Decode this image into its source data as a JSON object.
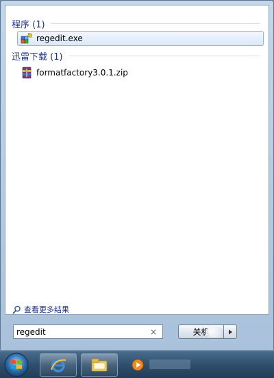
{
  "results": {
    "programs": {
      "header": "程序 (1)",
      "items": [
        {
          "label": "regedit.exe",
          "icon": "regedit-icon"
        }
      ]
    },
    "downloads": {
      "header": "迅雷下载 (1)",
      "items": [
        {
          "label": "formatfactory3.0.1.zip",
          "icon": "winrar-archive-icon"
        }
      ]
    },
    "see_more_label": "查看更多结果"
  },
  "search": {
    "value": "regedit",
    "clear_glyph": "×"
  },
  "shutdown": {
    "label": "关机",
    "arrow_glyph": "▶"
  },
  "colors": {
    "header_text": "#1e3287",
    "selection_border": "#8fb3dc",
    "taskbar": "#2f4f6d"
  },
  "taskbar": {
    "buttons": [
      "internet-explorer-icon",
      "file-explorer-icon",
      "media-player-icon"
    ]
  }
}
